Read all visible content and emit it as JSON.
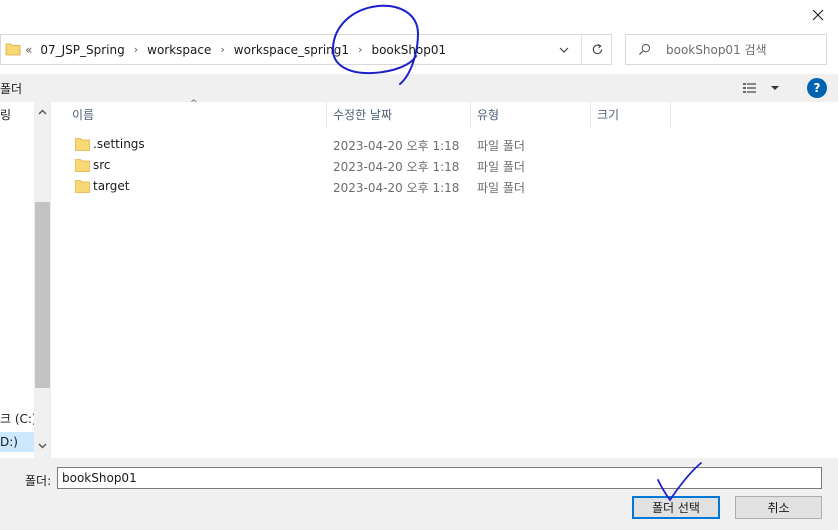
{
  "window": {
    "close_glyph": "✕"
  },
  "address_bar": {
    "overflow": "«",
    "breadcrumbs": [
      {
        "label": "07_JSP_Spring"
      },
      {
        "label": "workspace"
      },
      {
        "label": "workspace_spring1"
      },
      {
        "label": "bookShop01"
      }
    ],
    "separator": "›",
    "dropdown_icon": "chevron-down-icon",
    "refresh_icon": "refresh-icon"
  },
  "search": {
    "placeholder": "bookShop01 검색",
    "icon": "search-icon"
  },
  "toolbar": {
    "new_folder_label": "폴더",
    "view_icon": "view-options-icon",
    "help_label": "?"
  },
  "nav_pane": {
    "items": [
      {
        "label": "링"
      },
      {
        "label": "크 (C:)"
      },
      {
        "label": "D:)"
      }
    ]
  },
  "file_list": {
    "columns": [
      {
        "label": "이름"
      },
      {
        "label": "수정한 날짜"
      },
      {
        "label": "유형"
      },
      {
        "label": "크기"
      }
    ],
    "sort_indicator": "^",
    "rows": [
      {
        "name": ".settings",
        "modified": "2023-04-20 오후 1:18",
        "type": "파일 폴더",
        "size": ""
      },
      {
        "name": "src",
        "modified": "2023-04-20 오후 1:18",
        "type": "파일 폴더",
        "size": ""
      },
      {
        "name": "target",
        "modified": "2023-04-20 오후 1:18",
        "type": "파일 폴더",
        "size": ""
      }
    ]
  },
  "footer": {
    "folder_label": "폴더:",
    "folder_value": "bookShop01",
    "select_button": "폴더 선택",
    "cancel_button": "취소"
  },
  "colors": {
    "accent": "#0078d7",
    "folder_fill": "#f8d775",
    "annotation_ink": "#1a22c9"
  }
}
